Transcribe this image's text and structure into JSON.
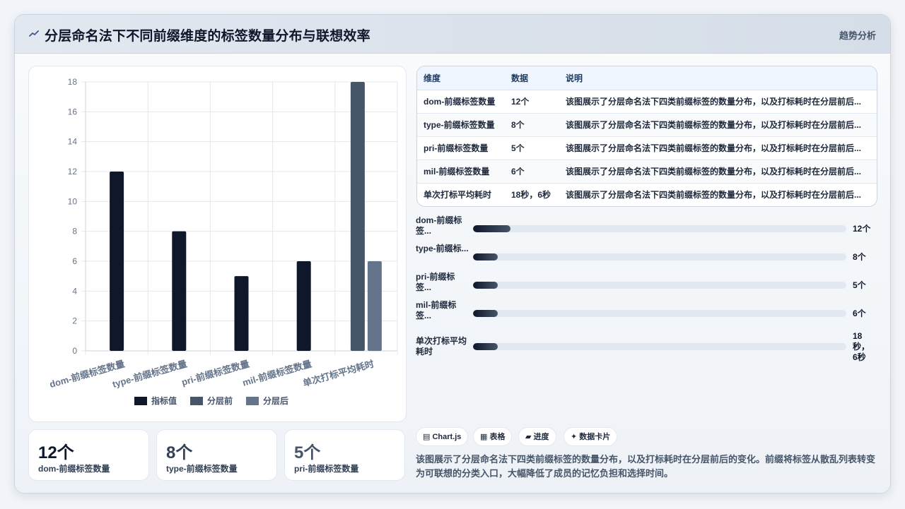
{
  "header": {
    "title": "分层命名法下不同前缀维度的标签数量分布与联想效率",
    "tag": "趋势分析"
  },
  "chart_data": {
    "type": "bar",
    "categories": [
      "dom-前缀标签数量",
      "type-前缀标签数量",
      "pri-前缀标签数量",
      "mil-前缀标签数量",
      "单次打标平均耗时"
    ],
    "series": [
      {
        "name": "指标值",
        "values": [
          12,
          8,
          5,
          6,
          null
        ],
        "color": "#0f172a"
      },
      {
        "name": "分层前",
        "values": [
          null,
          null,
          null,
          null,
          18
        ],
        "color": "#475569"
      },
      {
        "name": "分层后",
        "values": [
          null,
          null,
          null,
          null,
          6
        ],
        "color": "#64748b"
      }
    ],
    "ylim": [
      0,
      18
    ],
    "yticks": [
      0,
      2,
      4,
      6,
      8,
      10,
      12,
      14,
      16,
      18
    ],
    "grid": true,
    "legend": "bottom"
  },
  "stats": [
    {
      "value": "12个",
      "label": "dom-前缀标签数量",
      "color": "#0f172a"
    },
    {
      "value": "8个",
      "label": "type-前缀标签数量",
      "color": "#334155"
    },
    {
      "value": "5个",
      "label": "pri-前缀标签数量",
      "color": "#475569"
    }
  ],
  "table": {
    "headers": [
      "维度",
      "数据",
      "说明"
    ],
    "rows": [
      [
        "dom-前缀标签数量",
        "12个",
        "该图展示了分层命名法下四类前缀标签的数量分布，以及打标耗时在分层前后..."
      ],
      [
        "type-前缀标签数量",
        "8个",
        "该图展示了分层命名法下四类前缀标签的数量分布，以及打标耗时在分层前后..."
      ],
      [
        "pri-前缀标签数量",
        "5个",
        "该图展示了分层命名法下四类前缀标签的数量分布，以及打标耗时在分层前后..."
      ],
      [
        "mil-前缀标签数量",
        "6个",
        "该图展示了分层命名法下四类前缀标签的数量分布，以及打标耗时在分层前后..."
      ],
      [
        "单次打标平均耗时",
        "18秒，6秒",
        "该图展示了分层命名法下四类前缀标签的数量分布，以及打标耗时在分层前后..."
      ]
    ]
  },
  "progress": [
    {
      "label": "dom-前缀标签...",
      "value": "12个",
      "fraction": 0.1
    },
    {
      "label": "type-前缀标...",
      "value": "8个",
      "fraction": 0.066
    },
    {
      "label": "pri-前缀标签...",
      "value": "5个",
      "fraction": 0.066
    },
    {
      "label": "mil-前缀标签...",
      "value": "6个",
      "fraction": 0.066
    },
    {
      "label": "单次打标平均耗时",
      "value": "18秒，6秒",
      "fraction": 0.066
    }
  ],
  "pills": [
    {
      "icon": "chart-icon",
      "glyph": "▤",
      "label": "Chart.js"
    },
    {
      "icon": "table-icon",
      "glyph": "▦",
      "label": "表格"
    },
    {
      "icon": "progress-icon",
      "glyph": "▰",
      "label": "进度"
    },
    {
      "icon": "card-icon",
      "glyph": "✦",
      "label": "数据卡片"
    }
  ],
  "description": "该图展示了分层命名法下四类前缀标签的数量分布，以及打标耗时在分层前后的变化。前缀将标签从散乱列表转变为可联想的分类入口，大幅降低了成员的记忆负担和选择时间。"
}
